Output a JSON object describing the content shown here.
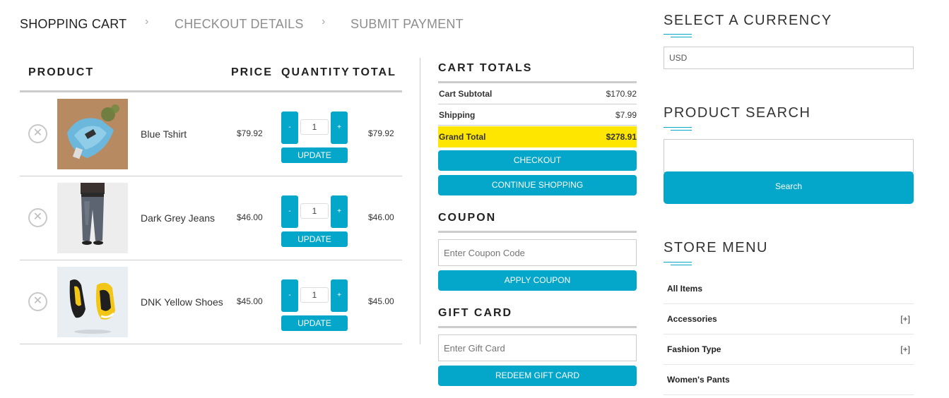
{
  "breadcrumb": {
    "steps": [
      "SHOPPING CART",
      "CHECKOUT DETAILS",
      "SUBMIT PAYMENT"
    ],
    "separator": "›"
  },
  "cart": {
    "headers": {
      "product": "PRODUCT",
      "price": "PRICE",
      "quantity": "QUANTITY",
      "total": "TOTAL"
    },
    "remove_symbol": "✕",
    "minus_label": "-",
    "plus_label": "+",
    "update_label": "UPDATE",
    "items": [
      {
        "name": "Blue Tshirt",
        "price": "$79.92",
        "quantity": "1",
        "total": "$79.92",
        "image": "blue-tshirt-image"
      },
      {
        "name": "Dark Grey Jeans",
        "price": "$46.00",
        "quantity": "1",
        "total": "$46.00",
        "image": "dark-grey-jeans-image"
      },
      {
        "name": "DNK Yellow Shoes",
        "price": "$45.00",
        "quantity": "1",
        "total": "$45.00",
        "image": "yellow-shoes-image"
      }
    ]
  },
  "totals": {
    "title": "CART TOTALS",
    "rows": [
      {
        "label": "Cart Subtotal",
        "value": "$170.92"
      },
      {
        "label": "Shipping",
        "value": "$7.99"
      },
      {
        "label": "Grand Total",
        "value": "$278.91"
      }
    ],
    "checkout_label": "CHECKOUT",
    "continue_label": "CONTINUE SHOPPING"
  },
  "coupon": {
    "title": "COUPON",
    "placeholder": "Enter Coupon Code",
    "button_label": "APPLY COUPON"
  },
  "gift_card": {
    "title": "GIFT CARD",
    "placeholder": "Enter Gift Card",
    "button_label": "REDEEM GIFT CARD"
  },
  "sidebar": {
    "currency": {
      "title": "SELECT A CURRENCY",
      "selected": "USD"
    },
    "search": {
      "title": "PRODUCT SEARCH",
      "value": "",
      "button_label": "Search"
    },
    "menu": {
      "title": "STORE MENU",
      "items": [
        {
          "label": "All Items",
          "expander": ""
        },
        {
          "label": "Accessories",
          "expander": "[+]"
        },
        {
          "label": "Fashion Type",
          "expander": "[+]"
        },
        {
          "label": "Women's Pants",
          "expander": ""
        }
      ]
    }
  },
  "colors": {
    "accent": "#04a6ca",
    "highlight": "#ffe600",
    "divider": "#cccccc"
  }
}
